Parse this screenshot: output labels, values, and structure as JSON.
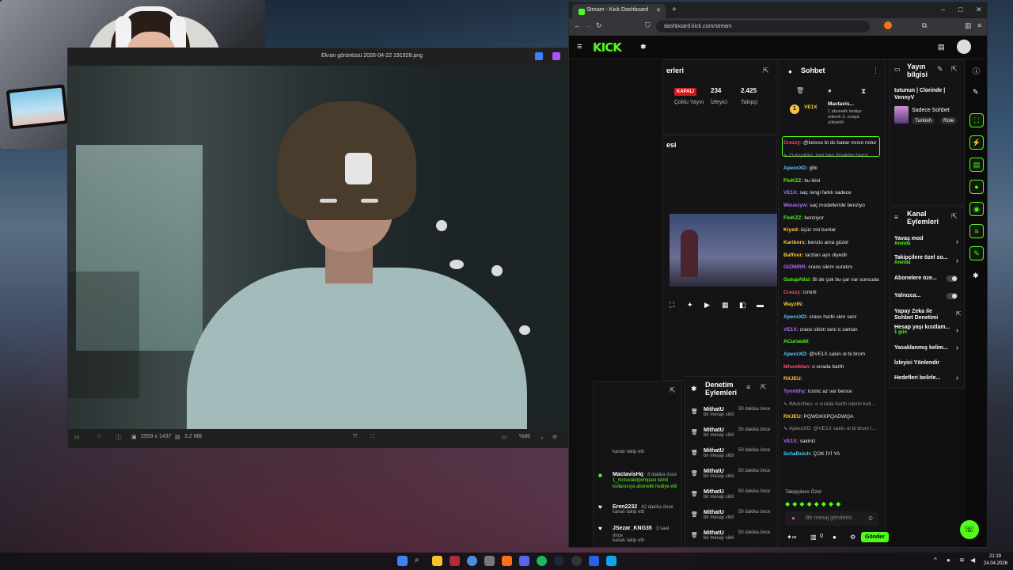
{
  "colors": {
    "kick_green": "#53fc18",
    "offline_red": "#d21a1a"
  },
  "viewer": {
    "title": "Ekran görüntüsü 2026-04-22 191928.png",
    "dimensions": "2559 x 1437",
    "filesize": "3.2 MB",
    "zoom": "%86"
  },
  "browser": {
    "tab_title": "Stream - Kick Dashboard",
    "url": "dashboard.kick.com/stream",
    "logo": "KICK"
  },
  "dashboard": {
    "stream_panel_title": "erleri",
    "status_badge": "KAPALI",
    "status_label": "Çoklu Yayın",
    "viewers_value": "234",
    "viewers_label": "İzleyici",
    "followers_value": "2.425",
    "followers_label": "Takipçi",
    "preview_title": "esi"
  },
  "chat": {
    "title": "Sohbet",
    "pinned_user": "Mactavis...",
    "pinned_text": "1 abonelik hediye ederek 3. sıraya yükseldi",
    "pinned_rank_user": "VE1X",
    "messages": [
      {
        "user": "Crezzy:",
        "text": " @keixos bi dc bakar mısın nolur",
        "color": "#ff4d6d"
      },
      {
        "user": "",
        "text": "↳ GutupAlisi: tam ben dicektim hepsi ...",
        "color": "#999"
      },
      {
        "user": "ApexxXD:",
        "text": " glbi",
        "color": "#4dd2ff"
      },
      {
        "user": "FloKZZ:",
        "text": " bu ikisi",
        "color": "#53fc18"
      },
      {
        "user": "VE1X:",
        "text": " saç rengi farklı sadece",
        "color": "#b26bff"
      },
      {
        "user": "Weuezyw:",
        "text": " saç modelleride benziyo",
        "color": "#b26bff"
      },
      {
        "user": "FloKZZ:",
        "text": " benziyor",
        "color": "#53fc18"
      },
      {
        "user": "Kiyed:",
        "text": " üçüz mü bunlar",
        "color": "#ffcc33"
      },
      {
        "user": "Kariborx:",
        "text": " benzio ama güzel",
        "color": "#ffcc33"
      },
      {
        "user": "Baffour:",
        "text": " tarzları ayrı diyedir",
        "color": "#ffcc33"
      },
      {
        "user": "GIZMIRR:",
        "text": " craos sikim suratını",
        "color": "#b26bff"
      },
      {
        "user": "GutupAlisi:",
        "text": " Bi de çok bu çar var suncuda",
        "color": "#53fc18"
      },
      {
        "user": "Crezzy:",
        "text": " izmirli",
        "color": "#ff4d6d"
      },
      {
        "user": "WayzIN:",
        "text": "",
        "color": "#ffcc33"
      },
      {
        "user": "ApexxXD:",
        "text": " craos harbi skm seni",
        "color": "#4dd2ff"
      },
      {
        "user": "VE1X:",
        "text": " craos sikim seni o zaman",
        "color": "#b26bff"
      },
      {
        "user": "ACursedd:",
        "text": "",
        "color": "#53fc18"
      },
      {
        "user": "ApexxXD:",
        "text": " @VE1X sakin ol bi brom",
        "color": "#4dd2ff"
      },
      {
        "user": "Mhoniklan:",
        "text": " o sırada barth",
        "color": "#ff4d6d"
      },
      {
        "user": "RXJEU:",
        "text": "",
        "color": "#ffcc33"
      },
      {
        "user": "Tyrmithy:",
        "text": " iconic az var bence",
        "color": "#b26bff"
      },
      {
        "user": "",
        "text": "↳ lMunchies: o sırada barth islemi kull...",
        "color": "#999"
      },
      {
        "user": "RXJEU:",
        "text": " PQWDKKPQADWQA",
        "color": "#ffcc33"
      },
      {
        "user": "",
        "text": "↳ ApexxXD: @VE1X sakin ol bi brom l...",
        "color": "#999"
      },
      {
        "user": "VE1X:",
        "text": " sakiniz",
        "color": "#b26bff"
      },
      {
        "user": "SchaDoich:",
        "text": " ÇOK İYİ YA",
        "color": "#4dd2ff"
      }
    ],
    "followers_only": "Takipçilere Özel",
    "input_placeholder": "Bir mesaj gönderin",
    "send_label": "Gönder",
    "count": "0"
  },
  "stream_info": {
    "title": "Yayın bilgisi",
    "stream_title": "tutunun | Clorinde | VennyV",
    "category": "Sadece Sohbet",
    "tags": [
      "Turkish",
      "Role"
    ]
  },
  "channel_actions": {
    "title": "Kanal Eylemleri",
    "items": [
      {
        "label": "Yavaş mod",
        "sub": "Anında"
      },
      {
        "label": "Takipçilere özel so...",
        "sub": "Anında"
      },
      {
        "label": "Abonelere öze...",
        "sub": ""
      },
      {
        "label": "Yalnızca...",
        "sub": ""
      },
      {
        "label": "Yapay Zeka ile Sohbet Denetimi",
        "sub": ""
      },
      {
        "label": "Hesap yaşı kısıtlam...",
        "sub": "1 gün"
      },
      {
        "label": "Yasaklanmış kelim...",
        "sub": ""
      },
      {
        "label": "İzleyici Yönlendir",
        "sub": ""
      },
      {
        "label": "Hedefleri belirle...",
        "sub": ""
      }
    ]
  },
  "mod_actions": {
    "title": "Denetim Eylemleri",
    "rows": [
      {
        "user": "MithatU",
        "time": "50 dakika önce",
        "text": "bir mesajı sildi"
      },
      {
        "user": "MithatU",
        "time": "50 dakika önce",
        "text": "bir mesajı sildi"
      },
      {
        "user": "MithatU",
        "time": "50 dakika önce",
        "text": "bir mesajı sildi"
      },
      {
        "user": "MithatU",
        "time": "50 dakika önce",
        "text": "bir mesajı sildi"
      },
      {
        "user": "MithatU",
        "time": "50 dakika önce",
        "text": "bir mesajı sildi"
      },
      {
        "user": "MithatU",
        "time": "50 dakika önce",
        "text": "bir mesajı sildi"
      },
      {
        "user": "MithatU",
        "time": "50 dakika önce",
        "text": "bir mesajı sildi"
      }
    ]
  },
  "activity": {
    "rows": [
      {
        "user": "MactavisHq",
        "time": "8 dakika önce",
        "text": "1_mctuvaletpompasi isimli kullanıcıya abonelik hediye etti"
      },
      {
        "user": "Eren2232",
        "time": "42 dakika önce",
        "text": "kanalı takip etti"
      },
      {
        "user": "JSezar_KNG35",
        "time": "3 saat önce",
        "text": "kanalı takip etti"
      }
    ],
    "partial": "kanalı takip etti"
  },
  "taskbar": {
    "time": "21:19",
    "date": "24.04.2026"
  }
}
